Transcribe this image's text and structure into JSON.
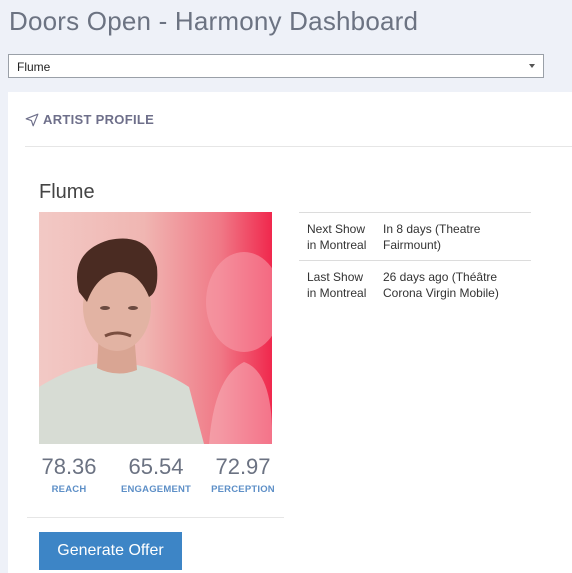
{
  "app": {
    "title": "Doors Open - Harmony Dashboard"
  },
  "artist_select": {
    "selected": "Flume"
  },
  "panel": {
    "header": "ARTIST PROFILE"
  },
  "artist": {
    "name": "Flume",
    "metrics": [
      {
        "value": "78.36",
        "label": "REACH"
      },
      {
        "value": "65.54",
        "label": "ENGAGEMENT"
      },
      {
        "value": "72.97",
        "label": "PERCEPTION"
      }
    ],
    "shows": [
      {
        "label": "Next Show in Montreal",
        "value": "In 8 days (Theatre Fairmount)"
      },
      {
        "label": "Last Show in Montreal",
        "value": "26 days ago (Théâtre Corona Virgin Mobile)"
      }
    ]
  },
  "actions": {
    "generate_offer": "Generate Offer"
  },
  "colors": {
    "accent": "#3d85c6",
    "metric_label": "#5d8fc7",
    "header": "#6e6f8a"
  },
  "icons": {
    "panel_header": "navigation-arrow-icon",
    "select": "chevron-down-icon"
  }
}
